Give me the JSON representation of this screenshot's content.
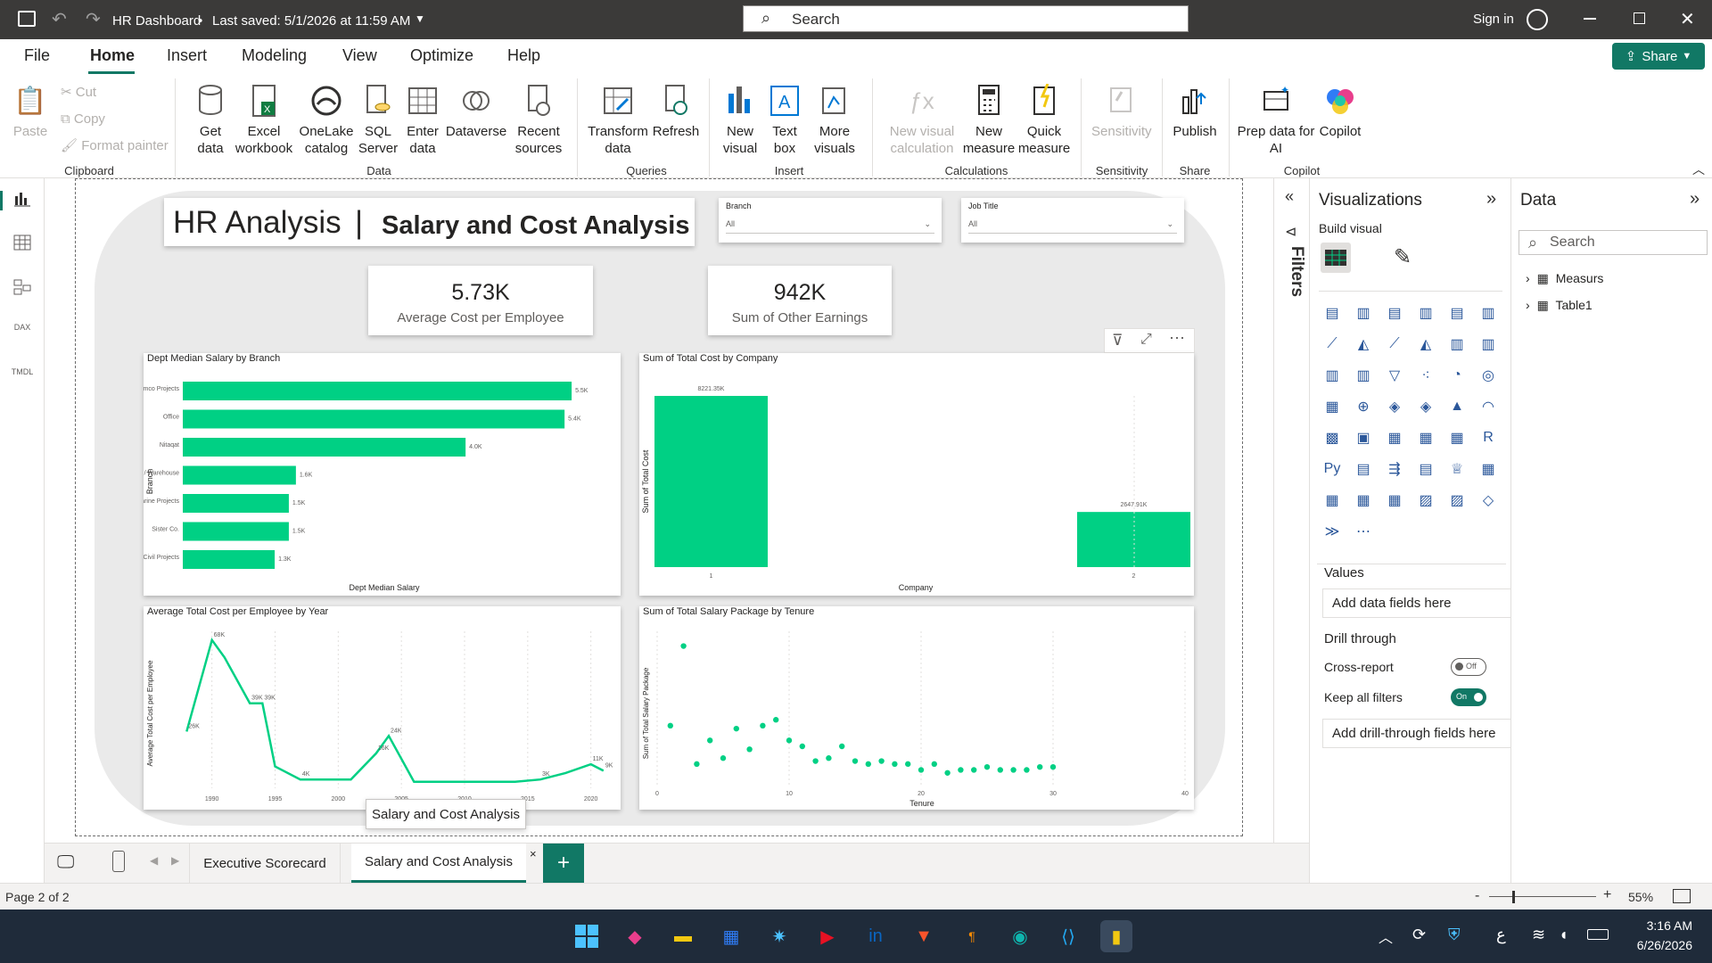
{
  "titlebar": {
    "title": "HR Dashboard",
    "saved": "Last saved: 5/1/2026 at 11:59 AM",
    "search_placeholder": "Search",
    "signin": "Sign in"
  },
  "menu": {
    "items": [
      "File",
      "Home",
      "Insert",
      "Modeling",
      "View",
      "Optimize",
      "Help"
    ],
    "active": "Home",
    "share": "Share"
  },
  "ribbon": {
    "clipboard": {
      "paste": "Paste",
      "cut": "Cut",
      "copy": "Copy",
      "format_painter": "Format painter",
      "group": "Clipboard"
    },
    "data": {
      "get_data": "Get data",
      "excel": "Excel workbook",
      "onelake": "OneLake catalog",
      "sql": "SQL Server",
      "enter": "Enter data",
      "dataverse": "Dataverse",
      "recent": "Recent sources",
      "group": "Data"
    },
    "queries": {
      "transform": "Transform data",
      "refresh": "Refresh",
      "group": "Queries"
    },
    "insert": {
      "new_visual": "New visual",
      "text_box": "Text box",
      "more_visuals": "More visuals",
      "group": "Insert"
    },
    "calculations": {
      "new_visual_calc": "New visual calculation",
      "new_measure": "New measure",
      "quick_measure": "Quick measure",
      "group": "Calculations"
    },
    "sensitivity": {
      "label": "Sensitivity",
      "group": "Sensitivity"
    },
    "share": {
      "publish": "Publish",
      "group": "Share"
    },
    "copilot": {
      "prep": "Prep data for AI",
      "copilot": "Copilot",
      "group": "Copilot"
    }
  },
  "report": {
    "title_left": "HR Analysis",
    "title_right": "Salary and Cost Analysis",
    "slicers": [
      {
        "label": "Branch",
        "value": "All"
      },
      {
        "label": "Job Title",
        "value": "All"
      }
    ],
    "kpis": [
      {
        "value": "5.73K",
        "label": "Average Cost per Employee"
      },
      {
        "value": "942K",
        "label": "Sum of Other Earnings"
      }
    ],
    "tooltip": "Salary and Cost Analysis"
  },
  "charts": {
    "bar": {
      "title": "Dept Median Salary by Branch",
      "xlabel": "Dept Median Salary",
      "ylabel": "Branch"
    },
    "column": {
      "title": "Sum of Total Cost by Company",
      "xlabel": "Company",
      "ylabel": "Sum of Total Cost"
    },
    "line": {
      "title": "Average Total Cost per Employee by Year",
      "ylabel": "Average Total Cost per Employee"
    },
    "scatter": {
      "title": "Sum of Total Salary Package by Tenure",
      "xlabel": "Tenure",
      "ylabel": "Sum of Total Salary Package"
    }
  },
  "chart_data": [
    {
      "type": "bar",
      "title": "Dept Median Salary by Branch",
      "categories": [
        "Alumco Projects",
        "Office",
        "Nitaqat",
        "Fleet / Warehouse",
        "Marine Projects",
        "Sister Co.",
        "Civil Projects"
      ],
      "values": [
        5500,
        5400,
        4000,
        1600,
        1500,
        1500,
        1300
      ],
      "labels": [
        "5.5K",
        "5.4K",
        "4.0K",
        "1.6K",
        "1.5K",
        "1.5K",
        "1.3K"
      ],
      "xlabel": "Dept Median Salary",
      "ylabel": "Branch",
      "color": "#00d084"
    },
    {
      "type": "bar",
      "title": "Sum of Total Cost by Company",
      "categories": [
        "1",
        "2"
      ],
      "values": [
        8221.35,
        2647.91
      ],
      "labels": [
        "8221.35K",
        "2647.91K"
      ],
      "xlabel": "Company",
      "ylabel": "Sum of Total Cost",
      "color": "#00d084"
    },
    {
      "type": "line",
      "title": "Average Total Cost per Employee by Year",
      "x": [
        1988,
        1990,
        1991,
        1993,
        1994,
        1995,
        1997,
        1999,
        2001,
        2003,
        2004,
        2006,
        2008,
        2010,
        2012,
        2014,
        2016,
        2018,
        2020,
        2021
      ],
      "values": [
        26,
        68,
        60,
        39,
        39,
        10,
        4,
        4,
        4,
        16,
        24,
        3,
        3,
        3,
        3,
        3,
        4,
        7,
        11,
        8
      ],
      "point_labels": {
        "0": "26K",
        "1": "68K",
        "3": "39K",
        "4": "39K",
        "6": "4K",
        "9": "16K",
        "10": "24K",
        "16": "3K",
        "18": "11K",
        "19": "9K"
      },
      "xticks": [
        "1990",
        "1995",
        "2000",
        "2005",
        "2010",
        "2015",
        "2020"
      ],
      "ylabel": "Average Total Cost per Employee",
      "color": "#00d084"
    },
    {
      "type": "scatter",
      "title": "Sum of Total Salary Package by Tenure",
      "x": [
        1,
        2,
        3,
        4,
        5,
        6,
        7,
        8,
        9,
        10,
        11,
        12,
        13,
        14,
        15,
        16,
        17,
        18,
        19,
        20,
        21,
        22,
        23,
        24,
        25,
        26,
        27,
        28,
        29,
        30,
        31,
        32,
        33,
        34,
        35,
        36,
        37
      ],
      "y": [
        48,
        75,
        35,
        43,
        37,
        47,
        40,
        48,
        50,
        43,
        41,
        36,
        37,
        41,
        36,
        35,
        36,
        35,
        35,
        33,
        35,
        32,
        33,
        33,
        34,
        33,
        33,
        33,
        34,
        34
      ],
      "xticks": [
        "0",
        "10",
        "20",
        "30",
        "40"
      ],
      "xlabel": "Tenure",
      "ylabel": "Sum of Total Salary Package",
      "color": "#00d084"
    }
  ],
  "filters": {
    "label": "Filters"
  },
  "viz": {
    "title": "Visualizations",
    "build": "Build visual",
    "values": "Values",
    "add_data": "Add data fields here",
    "drill": "Drill through",
    "cross": "Cross-report",
    "cross_state": "Off",
    "keep": "Keep all filters",
    "keep_state": "On",
    "add_drill": "Add drill-through fields here"
  },
  "data_pane": {
    "title": "Data",
    "search": "Search",
    "tables": [
      "Measurs",
      "Table1"
    ]
  },
  "tabs": {
    "items": [
      "Executive Scorecard",
      "Salary and Cost Analysis"
    ],
    "active": "Salary and Cost Analysis",
    "add": "+"
  },
  "status": {
    "page": "Page 2 of 2",
    "zoom": "55%"
  },
  "taskbar": {
    "time": "3:16 AM",
    "date": "6/26/2026",
    "lang": "ع"
  }
}
